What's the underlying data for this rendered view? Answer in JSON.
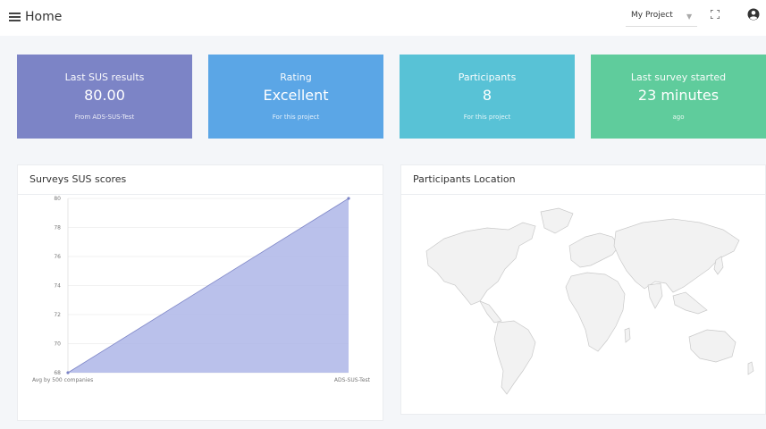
{
  "header": {
    "title": "Home",
    "project_select": "My Project"
  },
  "cards": {
    "sus": {
      "title": "Last SUS results",
      "value": "80.00",
      "sub": "From ADS-SUS-Test",
      "color": "#7c84c6"
    },
    "rating": {
      "title": "Rating",
      "value": "Excellent",
      "sub": "For this project",
      "color": "#5ba6e6"
    },
    "participants": {
      "title": "Participants",
      "value": "8",
      "sub": "For this project",
      "color": "#58c2d6"
    },
    "last_survey": {
      "title": "Last survey started",
      "value": "23 minutes",
      "sub": "ago",
      "color": "#5fcc9c"
    }
  },
  "chart_panel": {
    "title": "Surveys SUS scores"
  },
  "map_panel": {
    "title": "Participants Location"
  },
  "chart_data": {
    "type": "area",
    "categories": [
      "Avg by 500 companies",
      "ADS-SUS-Test"
    ],
    "values": [
      68,
      80
    ],
    "ylim": [
      68,
      80
    ],
    "yticks": [
      "80",
      "78",
      "76",
      "74",
      "72",
      "70",
      "68"
    ],
    "grid": true,
    "fill_color": "#aeb6e8",
    "line_color": "#7c84c6"
  }
}
